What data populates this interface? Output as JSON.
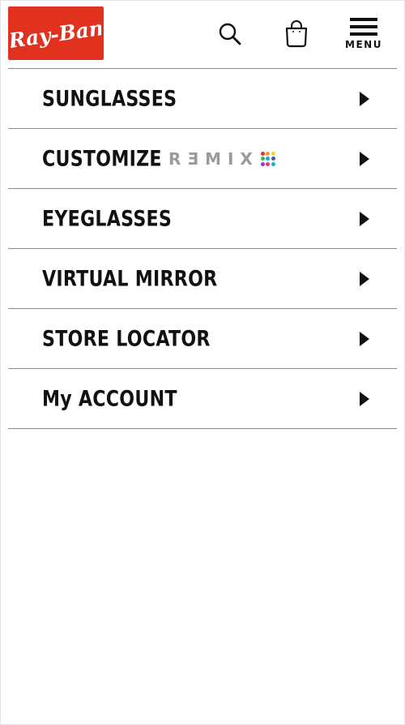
{
  "header": {
    "logo_text": "Ray-Ban",
    "logo_color": "#e0321f",
    "search_icon": "search-icon",
    "bag_icon": "shopping-bag-icon",
    "menu_icon": "hamburger-menu-icon",
    "menu_label": "MENU"
  },
  "nav": {
    "items": [
      {
        "label": "SUNGLASSES"
      },
      {
        "label": "CUSTOMIZE",
        "badge": "RƎMIX"
      },
      {
        "label": "EYEGLASSES"
      },
      {
        "label": "VIRTUAL MIRROR"
      },
      {
        "label": "STORE LOCATOR"
      },
      {
        "label": "My ACCOUNT"
      }
    ]
  },
  "remix_dot_colors": [
    "#e8312a",
    "#f39a1c",
    "#f5d21f",
    "#3ab54a",
    "#1aa7e0",
    "#2d5cc9",
    "#8a3fc4",
    "#e0378f",
    "#1fb5a6"
  ]
}
